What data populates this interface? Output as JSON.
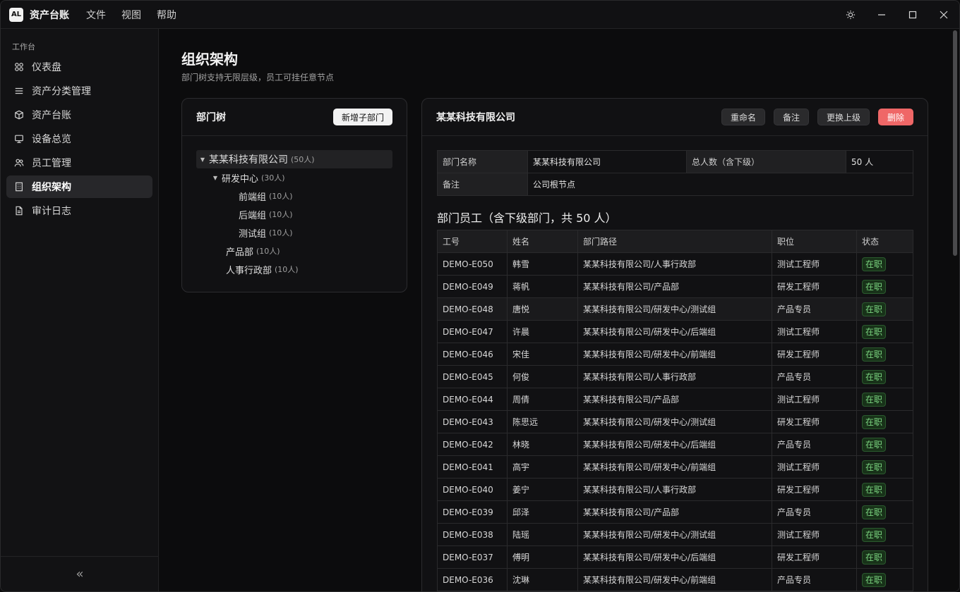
{
  "app": {
    "logo": "AL",
    "title": "资产台账",
    "menu": [
      "文件",
      "视图",
      "帮助"
    ]
  },
  "sidebar": {
    "heading": "工作台",
    "items": [
      {
        "label": "仪表盘",
        "icon": "dashboard-icon"
      },
      {
        "label": "资产分类管理",
        "icon": "list-icon"
      },
      {
        "label": "资产台账",
        "icon": "box-icon"
      },
      {
        "label": "设备总览",
        "icon": "monitor-icon"
      },
      {
        "label": "员工管理",
        "icon": "users-icon"
      },
      {
        "label": "组织架构",
        "icon": "building-icon",
        "active": true
      },
      {
        "label": "审计日志",
        "icon": "file-icon"
      }
    ],
    "collapse_icon": "«"
  },
  "page": {
    "title": "组织架构",
    "subtitle": "部门树支持无限层级，员工可挂任意节点"
  },
  "tree": {
    "title": "部门树",
    "add_button": "新增子部门",
    "nodes": [
      {
        "label": "某某科技有限公司",
        "count": "(50人)",
        "level": 0,
        "expanded": true,
        "selected": true
      },
      {
        "label": "研发中心",
        "count": "(30人)",
        "level": 1,
        "expanded": true
      },
      {
        "label": "前端组",
        "count": "(10人)",
        "level": 2
      },
      {
        "label": "后端组",
        "count": "(10人)",
        "level": 2
      },
      {
        "label": "测试组",
        "count": "(10人)",
        "level": 2
      },
      {
        "label": "产品部",
        "count": "(10人)",
        "level": 1
      },
      {
        "label": "人事行政部",
        "count": "(10人)",
        "level": 1
      }
    ]
  },
  "detail": {
    "title": "某某科技有限公司",
    "buttons": {
      "rename": "重命名",
      "note": "备注",
      "move": "更换上级",
      "delete": "删除"
    },
    "info": {
      "name_label": "部门名称",
      "name_value": "某某科技有限公司",
      "total_label": "总人数（含下级）",
      "total_value": "50 人",
      "note_label": "备注",
      "note_value": "公司根节点"
    },
    "section_title": "部门员工（含下级部门，共 50 人）",
    "columns": [
      "工号",
      "姓名",
      "部门路径",
      "职位",
      "状态"
    ],
    "rows": [
      [
        "DEMO-E050",
        "韩雪",
        "某某科技有限公司/人事行政部",
        "测试工程师",
        "在职"
      ],
      [
        "DEMO-E049",
        "蒋帆",
        "某某科技有限公司/产品部",
        "研发工程师",
        "在职"
      ],
      [
        "DEMO-E048",
        "唐悦",
        "某某科技有限公司/研发中心/测试组",
        "产品专员",
        "在职"
      ],
      [
        "DEMO-E047",
        "许晨",
        "某某科技有限公司/研发中心/后端组",
        "测试工程师",
        "在职"
      ],
      [
        "DEMO-E046",
        "宋佳",
        "某某科技有限公司/研发中心/前端组",
        "研发工程师",
        "在职"
      ],
      [
        "DEMO-E045",
        "何俊",
        "某某科技有限公司/人事行政部",
        "产品专员",
        "在职"
      ],
      [
        "DEMO-E044",
        "周倩",
        "某某科技有限公司/产品部",
        "测试工程师",
        "在职"
      ],
      [
        "DEMO-E043",
        "陈思远",
        "某某科技有限公司/研发中心/测试组",
        "研发工程师",
        "在职"
      ],
      [
        "DEMO-E042",
        "林晓",
        "某某科技有限公司/研发中心/后端组",
        "产品专员",
        "在职"
      ],
      [
        "DEMO-E041",
        "高宇",
        "某某科技有限公司/研发中心/前端组",
        "测试工程师",
        "在职"
      ],
      [
        "DEMO-E040",
        "姜宁",
        "某某科技有限公司/人事行政部",
        "研发工程师",
        "在职"
      ],
      [
        "DEMO-E039",
        "邱泽",
        "某某科技有限公司/产品部",
        "产品专员",
        "在职"
      ],
      [
        "DEMO-E038",
        "陆瑶",
        "某某科技有限公司/研发中心/测试组",
        "测试工程师",
        "在职"
      ],
      [
        "DEMO-E037",
        "傅明",
        "某某科技有限公司/研发中心/后端组",
        "研发工程师",
        "在职"
      ],
      [
        "DEMO-E036",
        "沈琳",
        "某某科技有限公司/研发中心/前端组",
        "产品专员",
        "在职"
      ]
    ]
  }
}
